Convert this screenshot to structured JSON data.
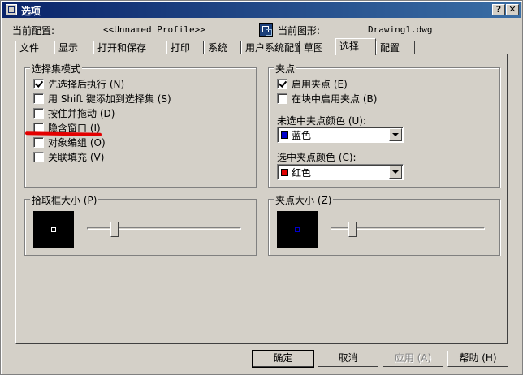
{
  "window": {
    "title": "选项"
  },
  "header": {
    "config_label": "当前配置:",
    "config_value": "<<Unnamed Profile>>",
    "drawing_label": "当前图形:",
    "drawing_value": "Drawing1.dwg"
  },
  "tabs": [
    "文件",
    "显示",
    "打开和保存",
    "打印",
    "系统",
    "用户系统配置",
    "草图",
    "选择",
    "配置"
  ],
  "active_tab": "选择",
  "selection_modes": {
    "legend": "选择集模式",
    "items": [
      {
        "label": "先选择后执行 (N)",
        "checked": true
      },
      {
        "label": "用 Shift 键添加到选择集 (S)",
        "checked": false
      },
      {
        "label": "按住并拖动 (D)",
        "checked": false
      },
      {
        "label": "隐含窗口 (I)",
        "checked": false
      },
      {
        "label": "对象编组 (O)",
        "checked": false
      },
      {
        "label": "关联填充 (V)",
        "checked": false
      }
    ]
  },
  "grips": {
    "legend": "夹点",
    "items": [
      {
        "label": "启用夹点 (E)",
        "checked": true
      },
      {
        "label": "在块中启用夹点 (B)",
        "checked": false
      }
    ],
    "unselected_color_label": "未选中夹点颜色 (U):",
    "unselected_color_value": "蓝色",
    "unselected_color_hex": "#0000cc",
    "selected_color_label": "选中夹点颜色 (C):",
    "selected_color_value": "红色",
    "selected_color_hex": "#e00000"
  },
  "pickbox": {
    "legend": "拾取框大小 (P)",
    "level": 0.16
  },
  "gripsize": {
    "legend": "夹点大小 (Z)",
    "level": 0.12
  },
  "buttons": {
    "ok": "确定",
    "cancel": "取消",
    "apply": "应用 (A)",
    "help": "帮助 (H)"
  },
  "annotation_color": "#e30000"
}
